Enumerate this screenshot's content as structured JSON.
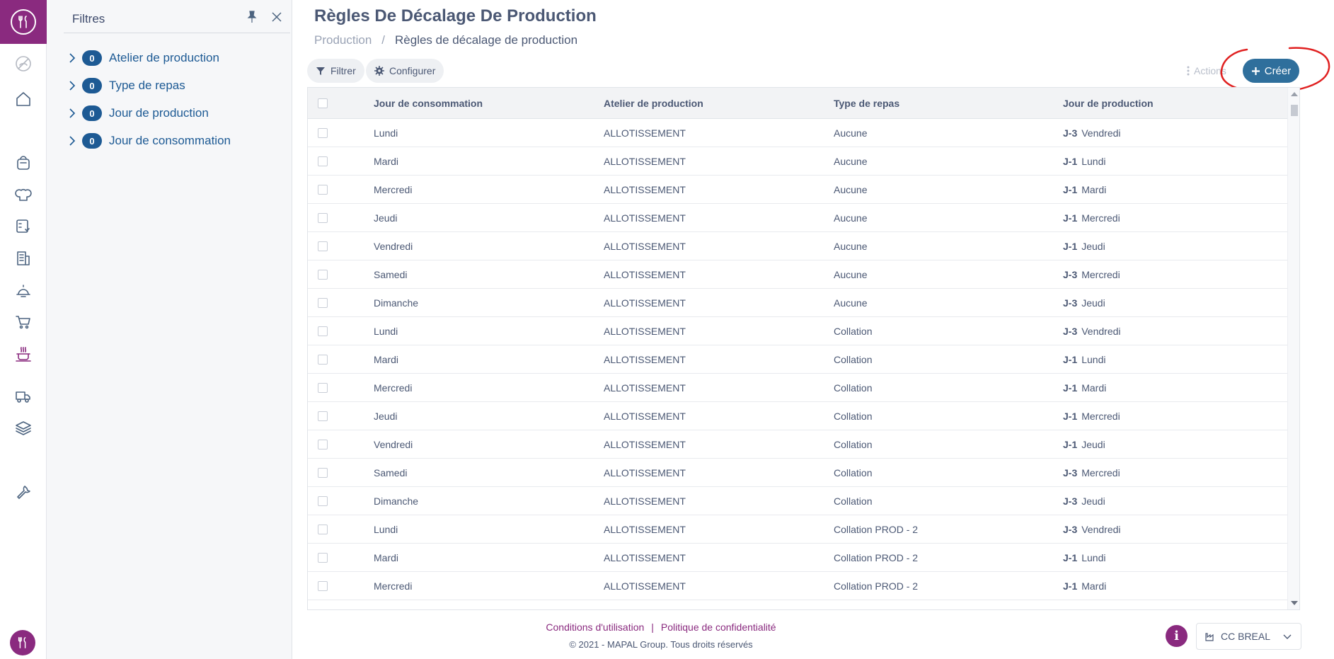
{
  "page": {
    "title": "Règles De Décalage De Production",
    "breadcrumb": [
      "Production",
      "Règles de décalage de production"
    ]
  },
  "filters": {
    "title": "Filtres",
    "facets": [
      {
        "count": "0",
        "label": "Atelier de production"
      },
      {
        "count": "0",
        "label": "Type de repas"
      },
      {
        "count": "0",
        "label": "Jour de production"
      },
      {
        "count": "0",
        "label": "Jour de consommation"
      }
    ]
  },
  "toolbar": {
    "filter_label": "Filtrer",
    "configure_label": "Configurer",
    "actions_label": "Actions",
    "create_label": "Créer"
  },
  "table": {
    "columns": [
      "Jour de consommation",
      "Atelier de production",
      "Type de repas",
      "Jour de production"
    ],
    "rows": [
      {
        "conso": "Lundi",
        "atelier": "ALLOTISSEMENT",
        "type": "Aucune",
        "offset": "J-3",
        "prod": "Vendredi"
      },
      {
        "conso": "Mardi",
        "atelier": "ALLOTISSEMENT",
        "type": "Aucune",
        "offset": "J-1",
        "prod": "Lundi"
      },
      {
        "conso": "Mercredi",
        "atelier": "ALLOTISSEMENT",
        "type": "Aucune",
        "offset": "J-1",
        "prod": "Mardi"
      },
      {
        "conso": "Jeudi",
        "atelier": "ALLOTISSEMENT",
        "type": "Aucune",
        "offset": "J-1",
        "prod": "Mercredi"
      },
      {
        "conso": "Vendredi",
        "atelier": "ALLOTISSEMENT",
        "type": "Aucune",
        "offset": "J-1",
        "prod": "Jeudi"
      },
      {
        "conso": "Samedi",
        "atelier": "ALLOTISSEMENT",
        "type": "Aucune",
        "offset": "J-3",
        "prod": "Mercredi"
      },
      {
        "conso": "Dimanche",
        "atelier": "ALLOTISSEMENT",
        "type": "Aucune",
        "offset": "J-3",
        "prod": "Jeudi"
      },
      {
        "conso": "Lundi",
        "atelier": "ALLOTISSEMENT",
        "type": "Collation",
        "offset": "J-3",
        "prod": "Vendredi"
      },
      {
        "conso": "Mardi",
        "atelier": "ALLOTISSEMENT",
        "type": "Collation",
        "offset": "J-1",
        "prod": "Lundi"
      },
      {
        "conso": "Mercredi",
        "atelier": "ALLOTISSEMENT",
        "type": "Collation",
        "offset": "J-1",
        "prod": "Mardi"
      },
      {
        "conso": "Jeudi",
        "atelier": "ALLOTISSEMENT",
        "type": "Collation",
        "offset": "J-1",
        "prod": "Mercredi"
      },
      {
        "conso": "Vendredi",
        "atelier": "ALLOTISSEMENT",
        "type": "Collation",
        "offset": "J-1",
        "prod": "Jeudi"
      },
      {
        "conso": "Samedi",
        "atelier": "ALLOTISSEMENT",
        "type": "Collation",
        "offset": "J-3",
        "prod": "Mercredi"
      },
      {
        "conso": "Dimanche",
        "atelier": "ALLOTISSEMENT",
        "type": "Collation",
        "offset": "J-3",
        "prod": "Jeudi"
      },
      {
        "conso": "Lundi",
        "atelier": "ALLOTISSEMENT",
        "type": "Collation PROD - 2",
        "offset": "J-3",
        "prod": "Vendredi"
      },
      {
        "conso": "Mardi",
        "atelier": "ALLOTISSEMENT",
        "type": "Collation PROD - 2",
        "offset": "J-1",
        "prod": "Lundi"
      },
      {
        "conso": "Mercredi",
        "atelier": "ALLOTISSEMENT",
        "type": "Collation PROD - 2",
        "offset": "J-1",
        "prod": "Mardi"
      }
    ]
  },
  "footer": {
    "terms": "Conditions d'utilisation",
    "separator": "|",
    "privacy": "Politique de confidentialité",
    "copyright": "© 2021 - MAPAL Group. Tous droits réservés",
    "site": "CC BREAL"
  },
  "icons": {
    "rail": [
      "fork-knife-logo-icon",
      "no-food-icon",
      "home-icon",
      "bag-icon",
      "chef-hat-icon",
      "checklist-heart-icon",
      "report-icon",
      "cloche-icon",
      "cart-icon",
      "production-pot-icon",
      "delivery-truck-icon",
      "stack-icon",
      "wrench-icon"
    ]
  },
  "colors": {
    "brand": "#8a2a7f",
    "primary_button": "#2f6f9c",
    "badge": "#1d5a94",
    "annotation": "#e02020"
  }
}
